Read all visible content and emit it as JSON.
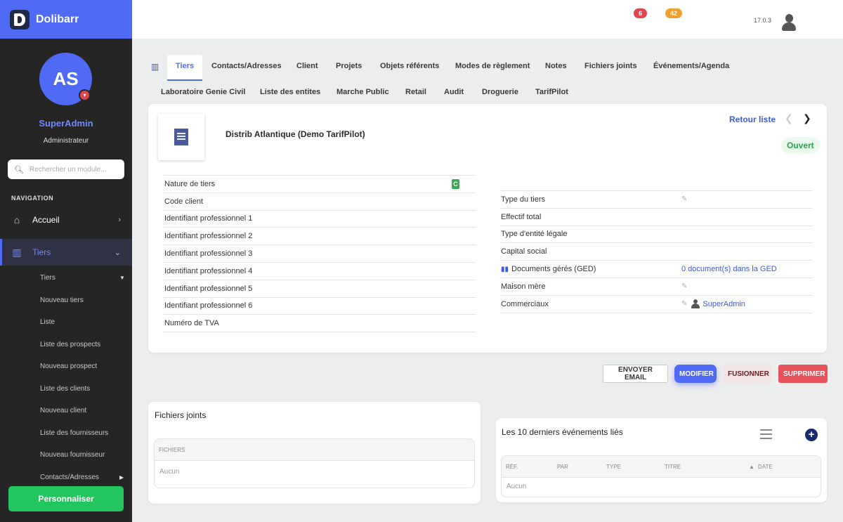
{
  "brand": {
    "name": "Dolibarr"
  },
  "user": {
    "initials": "AS",
    "name": "SuperAdmin",
    "role": "Administrateur"
  },
  "search": {
    "placeholder": "Rechercher un module..."
  },
  "nav": {
    "header": "NAVIGATION",
    "accueil": "Accueil",
    "tiers": "Tiers",
    "sub": [
      "Tiers",
      "Nouveau tiers",
      "Liste",
      "Liste des prospects",
      "Nouveau prospect",
      "Liste des clients",
      "Nouveau client",
      "Liste des fournisseurs",
      "Nouveau fournisseur",
      "Contacts/Adresses"
    ],
    "customize": "Personnaliser"
  },
  "topbar": {
    "badge1": "6",
    "badge2": "42",
    "version": "17.0.3"
  },
  "tabs": {
    "row1": [
      "Tiers",
      "Contacts/Adresses",
      "Client",
      "Projets",
      "Objets référents",
      "Modes de règlement",
      "Notes",
      "Fichiers joints",
      "Événements/Agenda"
    ],
    "row2": [
      "Laboratoire Genie Civil",
      "Liste des entites",
      "Marche Public",
      "Retail",
      "Audit",
      "Droguerie",
      "TarifPilot"
    ]
  },
  "thirdparty": {
    "name": "Distrib Atlantique (Demo TarifPilot)",
    "back": "Retour liste",
    "status": "Ouvert",
    "nature_badge": "C",
    "left_fields": [
      "Nature de tiers",
      "Code client",
      "Identifiant professionnel 1",
      "Identifiant professionnel 2",
      "Identifiant professionnel 3",
      "Identifiant professionnel 4",
      "Identifiant professionnel 5",
      "Identifiant professionnel 6",
      "Numéro de TVA"
    ],
    "right_fields": [
      "Type du tiers",
      "Effectif total",
      "Type d'entité légale",
      "Capital social",
      "Documents gérés (GED)",
      "Maison mère",
      "Commerciaux"
    ],
    "ged_value": "0 document(s) dans la GED",
    "sales_rep": "SuperAdmin"
  },
  "actions": {
    "email": "ENVOYER EMAIL",
    "modify": "MODIFIER",
    "merge": "FUSIONNER",
    "delete": "SUPPRIMER"
  },
  "files": {
    "title": "Fichiers joints",
    "col": "FICHIERS",
    "empty": "Aucun"
  },
  "events": {
    "title": "Les 10 derniers événements liés",
    "cols": [
      "RÉF.",
      "PAR",
      "TYPE",
      "TITRE",
      "DATE"
    ],
    "empty": "Aucun"
  }
}
